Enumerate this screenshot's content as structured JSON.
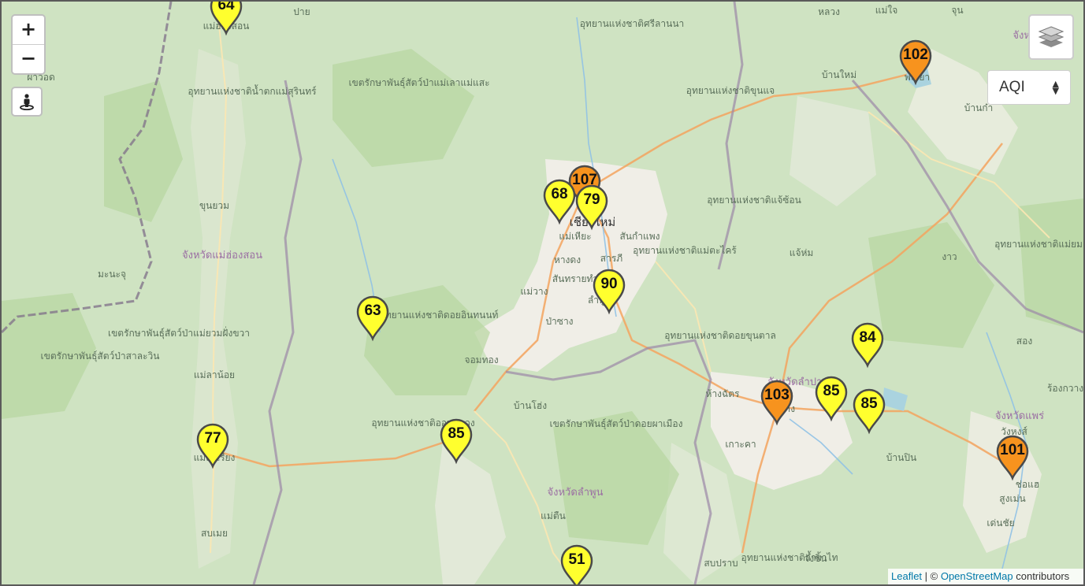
{
  "controls": {
    "zoom_in": "+",
    "zoom_out": "−",
    "locate_icon": "street-view-icon",
    "layers_icon": "layers-icon",
    "aqi_select": {
      "selected": "AQI",
      "icon": "select-arrows-icon"
    }
  },
  "attribution": {
    "leaflet": "Leaflet",
    "separator": " | © ",
    "osm": "OpenStreetMap",
    "suffix": " contributors"
  },
  "colors": {
    "moderate": "#ffff2e",
    "unhealthy_sensitive": "#f7931e",
    "marker_outline": "#4a4a4a"
  },
  "stations": [
    {
      "aqi": "64",
      "level": "moderate"
    },
    {
      "aqi": "102",
      "level": "unhealthy_sensitive"
    },
    {
      "aqi": "107",
      "level": "unhealthy_sensitive"
    },
    {
      "aqi": "68",
      "level": "moderate"
    },
    {
      "aqi": "79",
      "level": "moderate"
    },
    {
      "aqi": "90",
      "level": "moderate"
    },
    {
      "aqi": "63",
      "level": "moderate"
    },
    {
      "aqi": "84",
      "level": "moderate"
    },
    {
      "aqi": "103",
      "level": "unhealthy_sensitive"
    },
    {
      "aqi": "85",
      "level": "moderate"
    },
    {
      "aqi": "85",
      "level": "moderate"
    },
    {
      "aqi": "77",
      "level": "moderate"
    },
    {
      "aqi": "85",
      "level": "moderate"
    },
    {
      "aqi": "101",
      "level": "unhealthy_sensitive"
    },
    {
      "aqi": "51",
      "level": "moderate"
    }
  ],
  "place_labels": [
    "ปาย",
    "อุทยานแห่งชาติศรีลานนา",
    "หลวง",
    "แม่ใจ",
    "จุน",
    "จังหวัดพะเยา",
    "พะเยา",
    "บ้านใหม่",
    "บ้านก๋า",
    "แม่ฮ่องสอน",
    "ผาวอด",
    "อุทยานแห่งชาติน้ำตกแม่สุรินทร์",
    "เขตรักษาพันธุ์สัตว์ป่าแม่เลาแม่แสะ",
    "อุทยานแห่งชาติขุนแจ",
    "ขุนยวม",
    "จังหวัดแม่ฮ่องสอน",
    "มะนะจุ",
    "เชียงใหม่",
    "แม่เหียะ",
    "สันกำแพง",
    "หางดง",
    "สารภี",
    "สันทรายทำ",
    "แม่วาง",
    "ลำพูน",
    "ป่าซาง",
    "อุทยานแห่งชาติดอยอินทนนท์",
    "อุทยานแห่งชาติแจ้ซ้อน",
    "อุทยานแห่งชาติแม่ตะไคร้",
    "แจ้ห่ม",
    "งาว",
    "อุทยานแห่งชาติแม่ยม",
    "เขตรักษาพันธุ์สัตว์ป่าแม่ยวมฝั่งขวา",
    "เขตรักษาพันธุ์สัตว์ป่าสาละวิน",
    "แม่ลาน้อย",
    "จอมทอง",
    "อุทยานแห่งชาติดอยขุนตาล",
    "ห้างฉัตร",
    "จังหวัดลำปาง",
    "ลำปาง",
    "บ้านโฮ่ง",
    "เขตรักษาพันธุ์สัตว์ป่าดอยผาเมือง",
    "อุทยานแห่งชาติออบหลวง",
    "แม่สะเรียง",
    "เกาะคา",
    "จังหวัดแพร่",
    "วังหงส์",
    "ร้องกวาง",
    "สอง",
    "จังหวัดลำพูน",
    "บ้านปิน",
    "ช่อแฮ",
    "สูงเม่น",
    "แม่ตืน",
    "สบเมย",
    "เด่นชัย",
    "สบปราบ",
    "อุทยานแห่งชาติถ้ำผาไท",
    "วังชิ้น"
  ]
}
